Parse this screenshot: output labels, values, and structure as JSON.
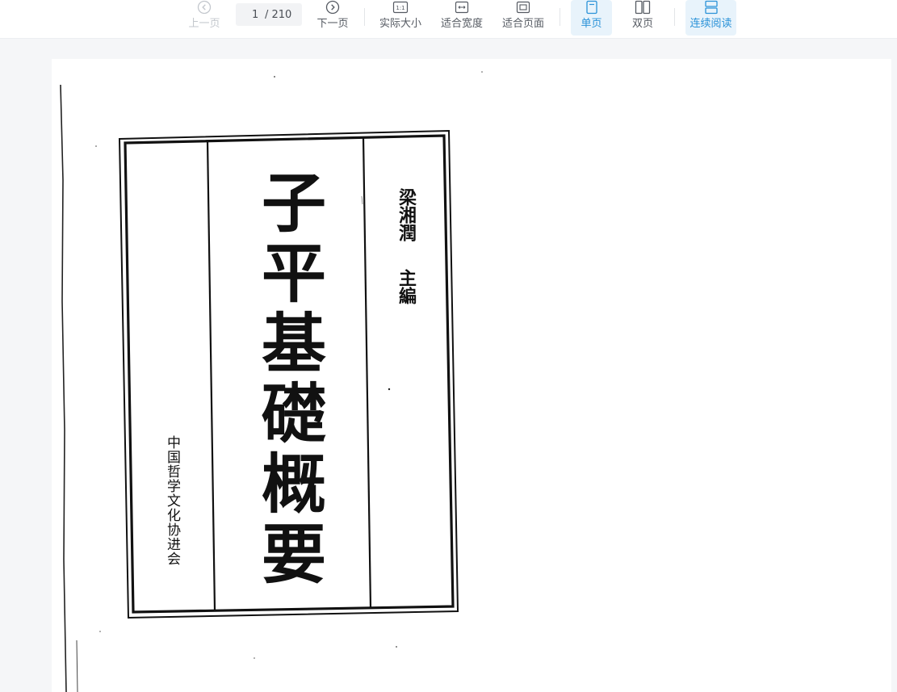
{
  "toolbar": {
    "prev_label": "上一页",
    "next_label": "下一页",
    "current_page": "1",
    "total_pages": "/ 210",
    "actual_size_label": "实际大小",
    "actual_size_icon_text": "1:1",
    "fit_width_label": "适合宽度",
    "fit_page_label": "适合页面",
    "single_page_label": "单页",
    "double_page_label": "双页",
    "continuous_label": "连续阅读",
    "accent_color": "#2a92d8",
    "active_bg": "#e8f3fb"
  },
  "document": {
    "title": "子平基礎概要",
    "editor_name": "梁湘潤",
    "editor_role": "主編",
    "publisher": "中国哲学文化协进会"
  }
}
